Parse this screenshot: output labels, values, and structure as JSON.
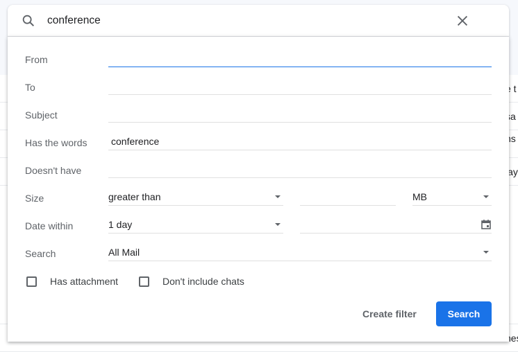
{
  "search": {
    "query": "conference"
  },
  "form": {
    "from": {
      "label": "From",
      "value": ""
    },
    "to": {
      "label": "To",
      "value": ""
    },
    "subject": {
      "label": "Subject",
      "value": ""
    },
    "has_words": {
      "label": "Has the words",
      "value": "conference"
    },
    "doesnt_have": {
      "label": "Doesn't have",
      "value": ""
    },
    "size": {
      "label": "Size",
      "operator": "greater than",
      "value": "",
      "unit": "MB"
    },
    "date_within": {
      "label": "Date within",
      "value": "1 day",
      "date": ""
    },
    "search_in": {
      "label": "Search",
      "value": "All Mail"
    },
    "has_attachment": {
      "label": "Has attachment",
      "checked": false
    },
    "no_chats": {
      "label": "Don't include chats",
      "checked": false
    }
  },
  "actions": {
    "create_filter": "Create filter",
    "search": "Search"
  },
  "background": {
    "fragments": [
      "e t",
      "sa",
      "ns",
      "lay",
      "nes"
    ]
  },
  "colors": {
    "accent": "#1a73e8"
  }
}
